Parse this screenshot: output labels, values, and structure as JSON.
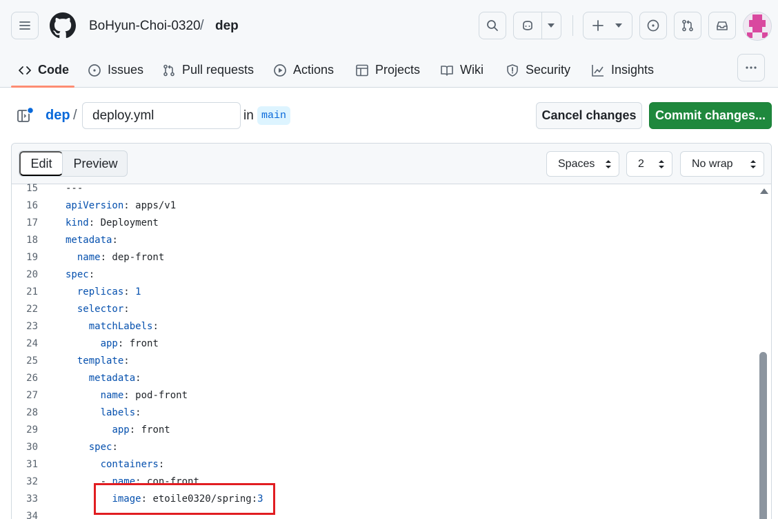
{
  "header": {
    "owner": "BoHyun-Choi-0320",
    "separator": "/",
    "repo": "dep"
  },
  "nav": {
    "items": [
      {
        "label": "Code",
        "icon": "code-icon",
        "active": true
      },
      {
        "label": "Issues",
        "icon": "issue-opened-icon"
      },
      {
        "label": "Pull requests",
        "icon": "git-pull-request-icon"
      },
      {
        "label": "Actions",
        "icon": "play-icon"
      },
      {
        "label": "Projects",
        "icon": "table-icon"
      },
      {
        "label": "Wiki",
        "icon": "book-icon"
      },
      {
        "label": "Security",
        "icon": "shield-icon"
      },
      {
        "label": "Insights",
        "icon": "graph-icon"
      }
    ]
  },
  "editor_header": {
    "repo_link": "dep",
    "separator": "/",
    "filename": "deploy.yml",
    "in_label": "in",
    "branch": "main",
    "cancel_label": "Cancel changes",
    "commit_label": "Commit changes..."
  },
  "toolbar": {
    "edit_label": "Edit",
    "preview_label": "Preview",
    "indent_mode": "Spaces",
    "indent_size": "2",
    "wrap_mode": "No wrap"
  },
  "code": {
    "lines": [
      {
        "num": "15",
        "indent": "",
        "key": "",
        "rest": "---"
      },
      {
        "num": "16",
        "indent": "",
        "key": "apiVersion",
        "rest": ": apps/v1"
      },
      {
        "num": "17",
        "indent": "",
        "key": "kind",
        "rest": ": Deployment"
      },
      {
        "num": "18",
        "indent": "",
        "key": "metadata",
        "rest": ":"
      },
      {
        "num": "19",
        "indent": "  ",
        "key": "name",
        "rest": ": dep-front"
      },
      {
        "num": "20",
        "indent": "",
        "key": "spec",
        "rest": ":"
      },
      {
        "num": "21",
        "indent": "  ",
        "key": "replicas",
        "rest": ": ",
        "num_val": "1"
      },
      {
        "num": "22",
        "indent": "  ",
        "key": "selector",
        "rest": ":"
      },
      {
        "num": "23",
        "indent": "    ",
        "key": "matchLabels",
        "rest": ":"
      },
      {
        "num": "24",
        "indent": "      ",
        "key": "app",
        "rest": ": front"
      },
      {
        "num": "25",
        "indent": "  ",
        "key": "template",
        "rest": ":"
      },
      {
        "num": "26",
        "indent": "    ",
        "key": "metadata",
        "rest": ":"
      },
      {
        "num": "27",
        "indent": "      ",
        "key": "name",
        "rest": ": pod-front"
      },
      {
        "num": "28",
        "indent": "      ",
        "key": "labels",
        "rest": ":"
      },
      {
        "num": "29",
        "indent": "        ",
        "key": "app",
        "rest": ": front"
      },
      {
        "num": "30",
        "indent": "    ",
        "key": "spec",
        "rest": ":"
      },
      {
        "num": "31",
        "indent": "      ",
        "key": "containers",
        "rest": ":"
      },
      {
        "num": "32",
        "indent": "      - ",
        "key": "name",
        "rest": ": con-front"
      },
      {
        "num": "33",
        "indent": "        ",
        "key": "image",
        "rest": ": etoile0320/spring:",
        "num_val": "3"
      },
      {
        "num": "34",
        "indent": "",
        "key": "",
        "rest": ""
      }
    ]
  },
  "colors": {
    "accent_blue": "#0969da",
    "commit_green": "#1f883d",
    "highlight_red": "#e11d21",
    "nav_underline": "#fd8c73"
  }
}
